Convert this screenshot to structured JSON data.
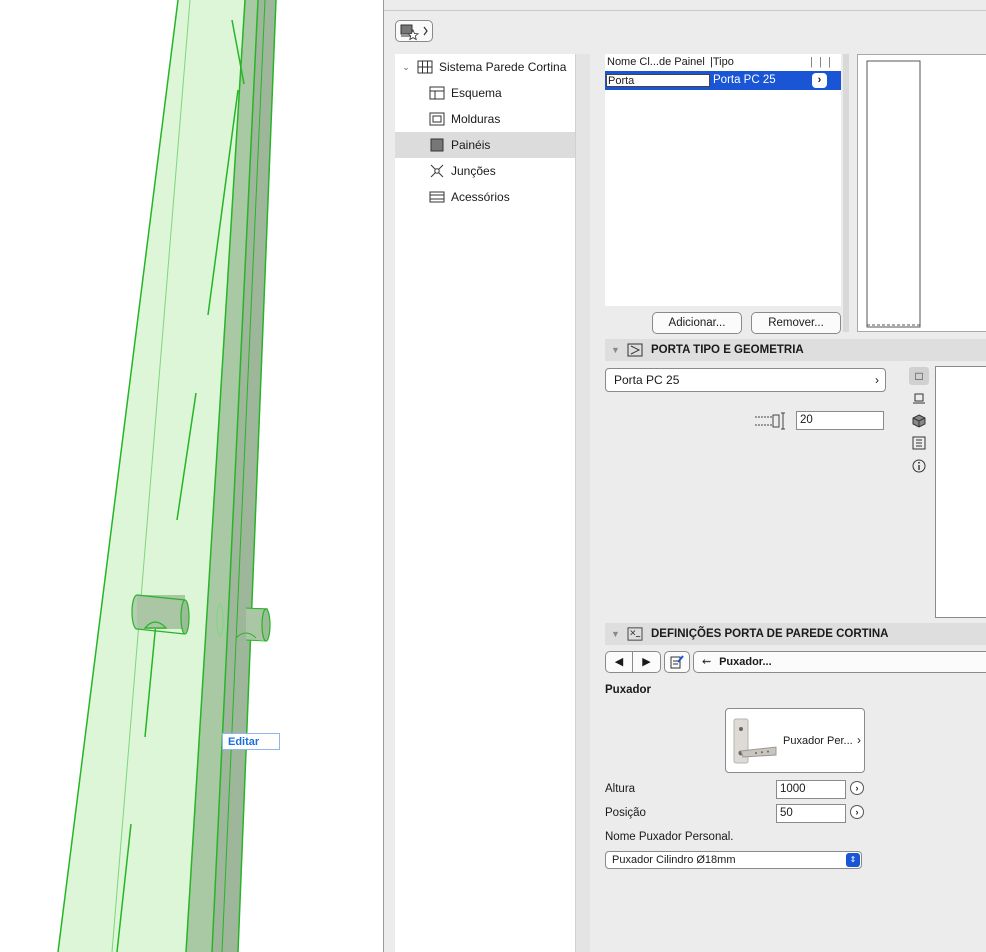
{
  "viewport": {
    "edit_tag": "Editar"
  },
  "tree": {
    "items": [
      {
        "label": "Sistema Parede Cortina",
        "icon": "curtain-wall-grid-icon"
      },
      {
        "label": "Esquema",
        "icon": "scheme-icon"
      },
      {
        "label": "Molduras",
        "icon": "frame-icon"
      },
      {
        "label": "Painéis",
        "icon": "panel-icon",
        "selected": true
      },
      {
        "label": "Junções",
        "icon": "junction-icon"
      },
      {
        "label": "Acessórios",
        "icon": "accessory-icon"
      }
    ]
  },
  "panel_table": {
    "col_name": "Nome Cl...de Painel",
    "col_tipo": "|Tipo",
    "selected_row": {
      "name": "Porta",
      "tipo": "Porta PC 25"
    }
  },
  "buttons": {
    "add": "Adicionar...",
    "remove": "Remover..."
  },
  "section_door": {
    "title": "PORTA TIPO E GEOMETRIA",
    "type_value": "Porta PC 25",
    "thickness_value": "20"
  },
  "section_settings": {
    "title": "DEFINIÇÕES PORTA DE PAREDE CORTINA",
    "page_label": "Puxador..."
  },
  "handle": {
    "heading": "Puxador",
    "card_label": "Puxador Per...",
    "altura_label": "Altura",
    "altura_value": "1000",
    "posicao_label": "Posição",
    "posicao_value": "50",
    "nome_label": "Nome Puxador Personal.",
    "nome_value": "Puxador Cilindro Ø18mm"
  },
  "colors": {
    "selection_blue": "#1a55d6",
    "wall_green": "#26b526",
    "wall_fill": "#d9f5d4"
  }
}
